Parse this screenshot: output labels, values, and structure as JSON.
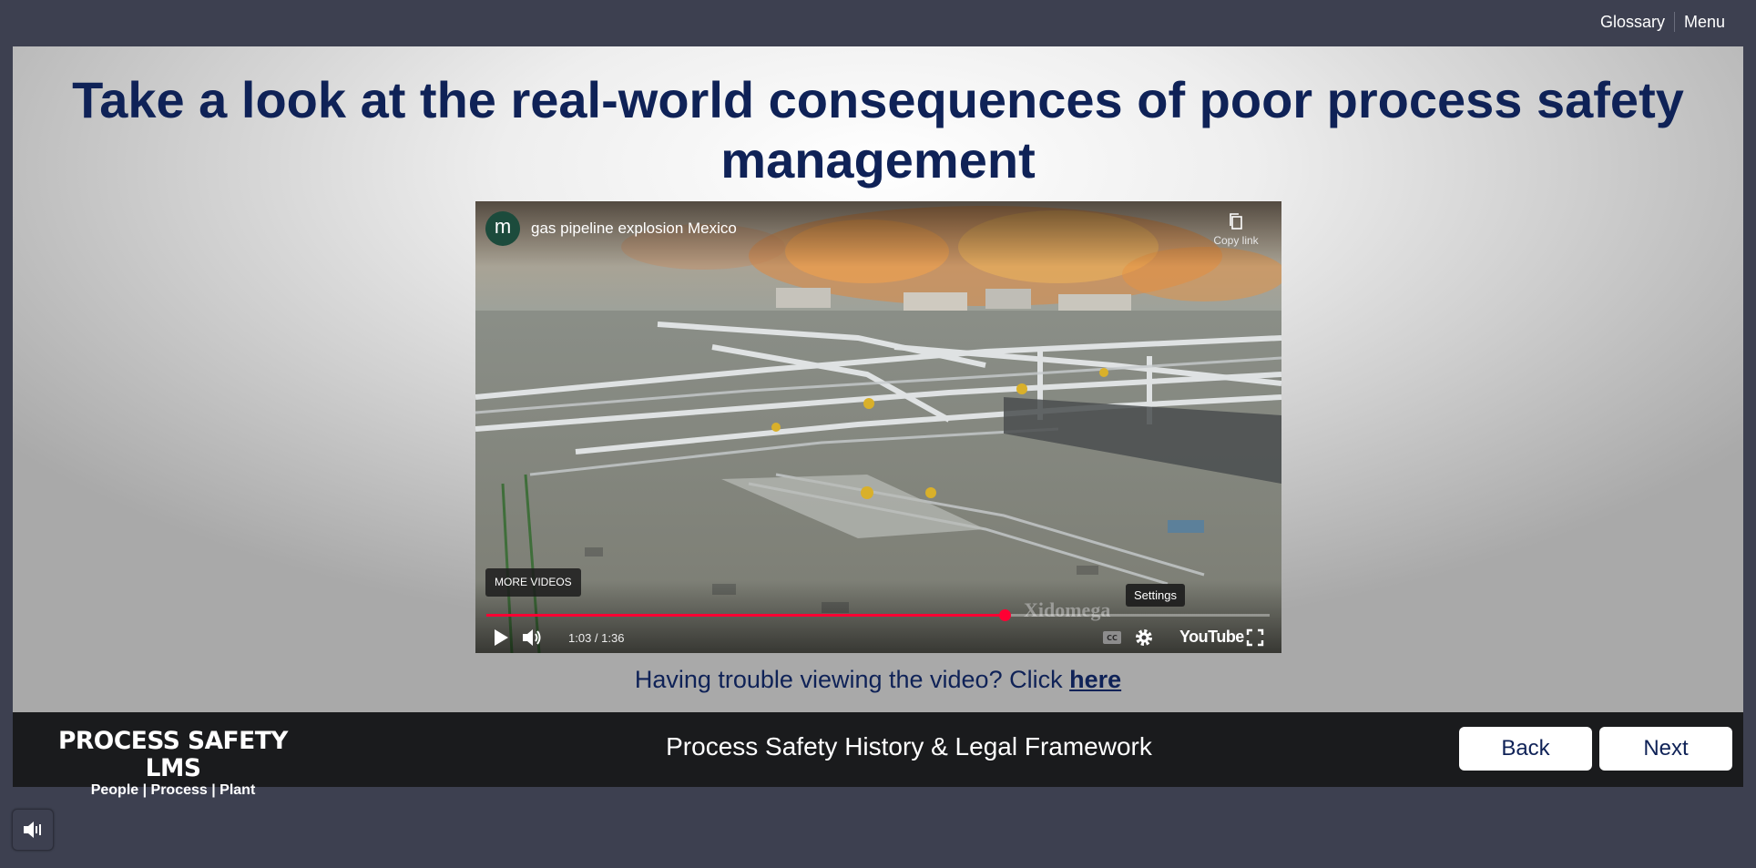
{
  "topnav": {
    "glossary": "Glossary",
    "menu": "Menu"
  },
  "slide": {
    "title": "Take a look at the real-world consequences of poor process safety management",
    "trouble_text": "Having trouble viewing the video? Click ",
    "trouble_link": "here"
  },
  "video": {
    "channel_initial": "m",
    "title": "gas pipeline explosion Mexico",
    "copy_link": "Copy link",
    "more_videos": "MORE VIDEOS",
    "settings_tooltip": "Settings",
    "watermark": "Xidomega",
    "time": "1:03 / 1:36",
    "progress": 0.6615,
    "youtube_logo": "YouTube",
    "icons": [
      "copy-icon",
      "play-icon",
      "volume-icon",
      "captions-icon",
      "gear-icon",
      "fullscreen-icon"
    ]
  },
  "footer": {
    "logo_line1": "PROCESS SAFETY LMS",
    "logo_line2": "People | Process | Plant",
    "course_title": "Process Safety History & Legal Framework",
    "back_label": "Back",
    "next_label": "Next"
  },
  "audio": {
    "icon": "speaker-icon"
  },
  "colors": {
    "title_navy": "#0f2257",
    "footer_bg": "#1a1b1d",
    "chrome_bg": "#3d4050",
    "progress_red": "#ff0033"
  }
}
